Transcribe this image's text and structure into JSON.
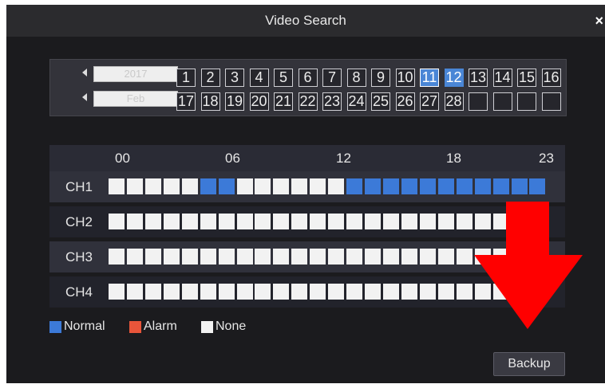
{
  "window": {
    "title": "Video Search",
    "close_glyph": "×"
  },
  "calendar": {
    "year": "2017",
    "month": "Feb",
    "days": [
      "1",
      "2",
      "3",
      "4",
      "5",
      "6",
      "7",
      "8",
      "9",
      "10",
      "11",
      "12",
      "13",
      "14",
      "15",
      "16",
      "17",
      "18",
      "19",
      "20",
      "21",
      "22",
      "23",
      "24",
      "25",
      "26",
      "27",
      "28"
    ],
    "selected_day": "11",
    "highlighted_days": [
      "12"
    ]
  },
  "timeline": {
    "hour_labels": [
      "00",
      "06",
      "12",
      "18",
      "23"
    ],
    "channels": [
      {
        "label": "CH1",
        "slots": [
          "none",
          "none",
          "none",
          "none",
          "none",
          "normal",
          "normal",
          "none",
          "none",
          "none",
          "none",
          "none",
          "none",
          "normal",
          "normal",
          "normal",
          "normal",
          "normal",
          "normal",
          "normal",
          "normal",
          "normal",
          "normal",
          "normal"
        ]
      },
      {
        "label": "CH2",
        "slots": [
          "none",
          "none",
          "none",
          "none",
          "none",
          "none",
          "none",
          "none",
          "none",
          "none",
          "none",
          "none",
          "none",
          "none",
          "none",
          "none",
          "none",
          "none",
          "none",
          "none",
          "none",
          "none",
          "none",
          "none"
        ]
      },
      {
        "label": "CH3",
        "slots": [
          "none",
          "none",
          "none",
          "none",
          "none",
          "none",
          "none",
          "none",
          "none",
          "none",
          "none",
          "none",
          "none",
          "none",
          "none",
          "none",
          "none",
          "none",
          "none",
          "none",
          "none",
          "none",
          "none",
          "none"
        ]
      },
      {
        "label": "CH4",
        "slots": [
          "none",
          "none",
          "none",
          "none",
          "none",
          "none",
          "none",
          "none",
          "none",
          "none",
          "none",
          "none",
          "none",
          "none",
          "none",
          "none",
          "none",
          "none",
          "none",
          "none",
          "none",
          "none",
          "none",
          "none"
        ]
      }
    ]
  },
  "legend": {
    "normal": "Normal",
    "alarm": "Alarm",
    "none": "None"
  },
  "colors": {
    "normal": "#3c7ad8",
    "alarm": "#e8553a",
    "none": "#f2f2f2",
    "annotation_arrow": "#ff0000"
  },
  "buttons": {
    "backup": "Backup"
  }
}
